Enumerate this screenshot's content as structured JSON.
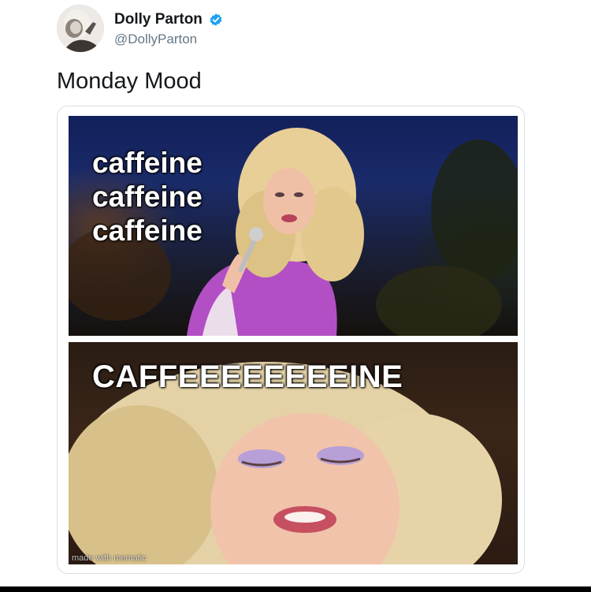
{
  "author": {
    "display_name": "Dolly Parton",
    "handle": "@DollyParton",
    "verified": true
  },
  "tweet": {
    "text": "Monday Mood"
  },
  "media": {
    "top_panel": {
      "lines": [
        "caffeine",
        "caffeine",
        "caffeine"
      ]
    },
    "bottom_panel": {
      "caption": "CAFFEEEEEEEEINE"
    },
    "watermark": "made with mematic"
  },
  "colors": {
    "verified_badge": "#1da1f2",
    "text_primary": "#14171a",
    "text_secondary": "#657786",
    "dress": "#b24fc4",
    "hair": "#e8cf97"
  },
  "icons": {
    "verified": "verified-badge-icon"
  }
}
